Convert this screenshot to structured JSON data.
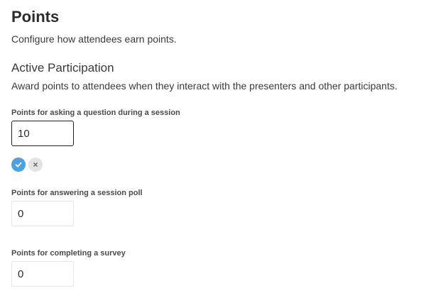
{
  "page": {
    "title": "Points",
    "description": "Configure how attendees earn points."
  },
  "section": {
    "title": "Active Participation",
    "description": "Award points to attendees when they interact with the presenters and other participants."
  },
  "fields": [
    {
      "label": "Points for asking a question during a session",
      "value": "10",
      "state": "editing"
    },
    {
      "label": "Points for answering a session poll",
      "value": "0",
      "state": "idle"
    },
    {
      "label": "Points for completing a survey",
      "value": "0",
      "state": "idle"
    }
  ],
  "actions": {
    "confirm_icon": "check-icon",
    "cancel_icon": "close-icon"
  },
  "colors": {
    "confirm": "#4aa3e0",
    "cancel": "#e4e4e4",
    "active_border": "#1f1f1f",
    "idle_border": "#e6e6e6"
  }
}
